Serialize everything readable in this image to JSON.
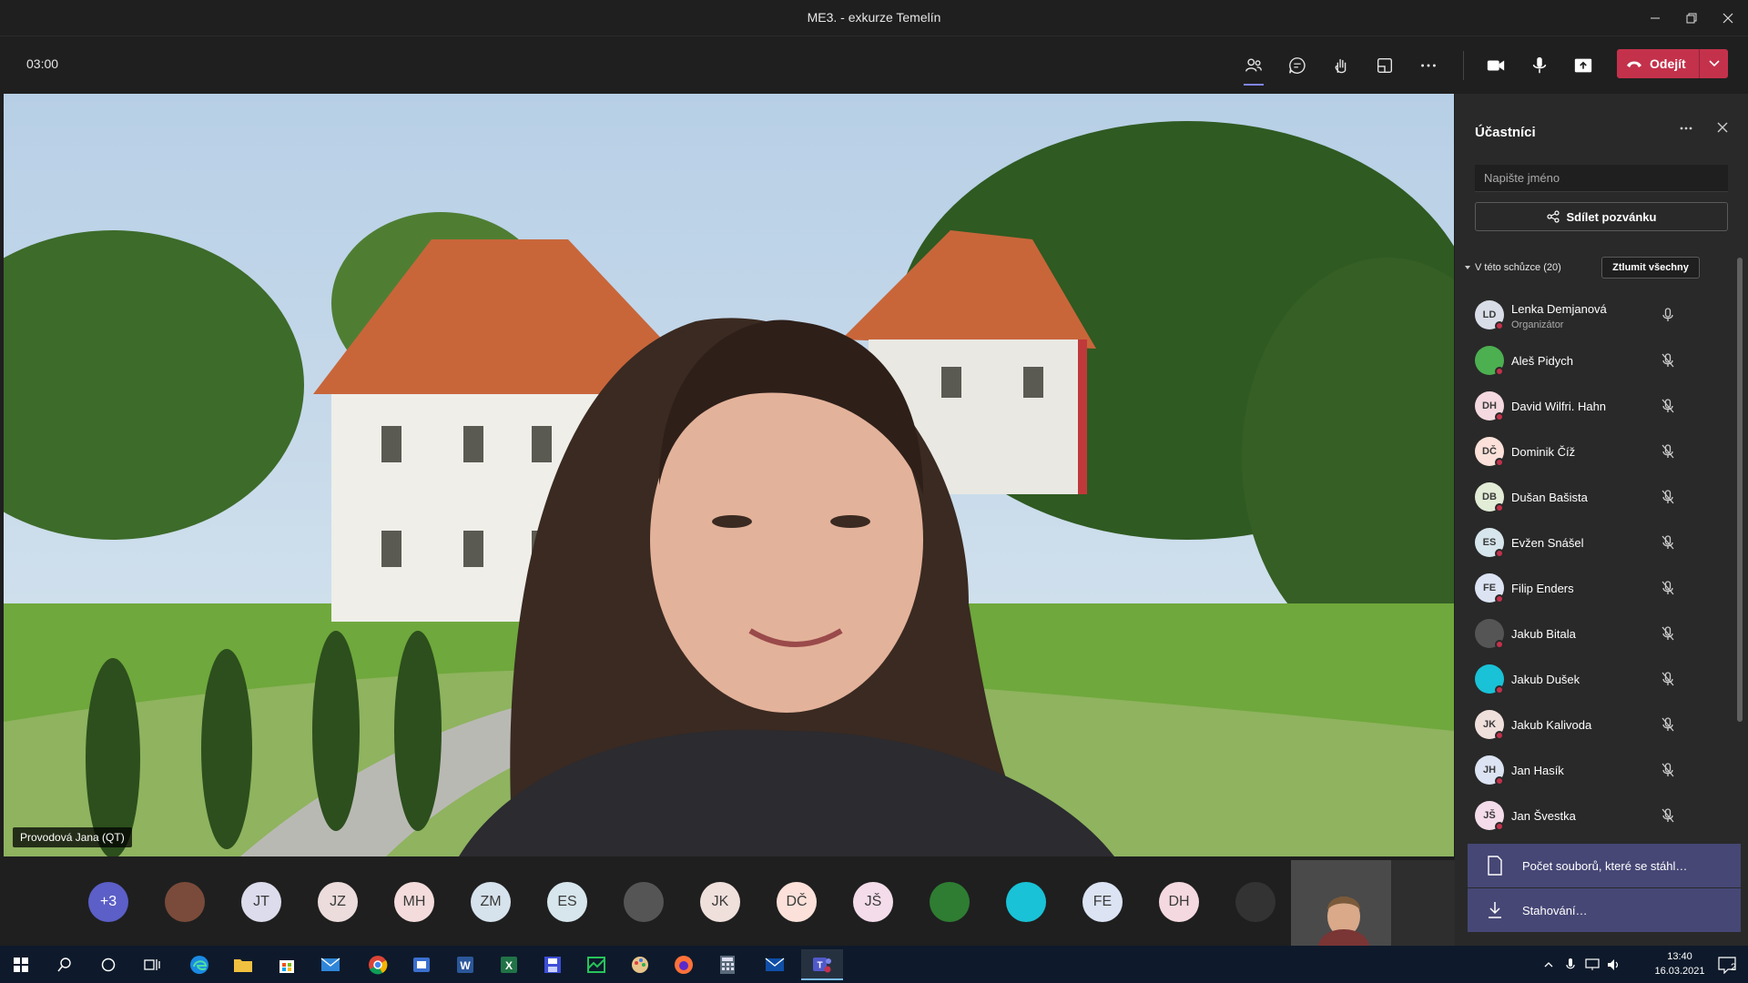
{
  "window": {
    "title": "ME3. - exkurze Temelín"
  },
  "toolbar": {
    "timer": "03:00",
    "leave_label": "Odejít"
  },
  "video": {
    "name_tag": "Provodová Jana (QT)"
  },
  "panel": {
    "title": "Účastníci",
    "search_placeholder": "Napište jméno",
    "share_label": "Sdílet pozvánku",
    "section_label": "V této schůzce (20)",
    "mute_all_label": "Ztlumit všechny",
    "participants": [
      {
        "initials": "LD",
        "name": "Lenka Demjanová",
        "role": "Organizátor",
        "color": "#d9dde8",
        "mic": "on"
      },
      {
        "initials": "",
        "name": "Aleš Pidych",
        "role": "",
        "color": "#4caf50",
        "mic": "off"
      },
      {
        "initials": "DH",
        "name": "David Wilfri. Hahn",
        "role": "",
        "color": "#f5d9e0",
        "mic": "off"
      },
      {
        "initials": "DČ",
        "name": "Dominik Číž",
        "role": "",
        "color": "#fbe1d9",
        "mic": "off"
      },
      {
        "initials": "DB",
        "name": "Dušan Bašista",
        "role": "",
        "color": "#e2ecd6",
        "mic": "off"
      },
      {
        "initials": "ES",
        "name": "Evžen Snášel",
        "role": "",
        "color": "#d6e6ec",
        "mic": "off"
      },
      {
        "initials": "FE",
        "name": "Filip Enders",
        "role": "",
        "color": "#dce4f4",
        "mic": "off"
      },
      {
        "initials": "",
        "name": "Jakub Bitala",
        "role": "",
        "color": "#555555",
        "mic": "off"
      },
      {
        "initials": "",
        "name": "Jakub Dušek",
        "role": "",
        "color": "#19c2d6",
        "mic": "off"
      },
      {
        "initials": "JK",
        "name": "Jakub Kalivoda",
        "role": "",
        "color": "#f0e0dc",
        "mic": "off"
      },
      {
        "initials": "JH",
        "name": "Jan Hasík",
        "role": "",
        "color": "#dce4f4",
        "mic": "off"
      },
      {
        "initials": "JŠ",
        "name": "Jan Švestka",
        "role": "",
        "color": "#f4dcea",
        "mic": "off"
      }
    ]
  },
  "notifications": [
    {
      "text": "Počet souborů, které se stáhl…"
    },
    {
      "text": "Stahování…"
    }
  ],
  "strip": {
    "avatars": [
      {
        "label": "+3",
        "color": "#5b5fc7",
        "text_color": "#ffffff"
      },
      {
        "label": "",
        "color": "#7a4b3a",
        "text_color": "#ffffff"
      },
      {
        "label": "JT",
        "color": "#dcdcec",
        "text_color": "#3a3a3a"
      },
      {
        "label": "JZ",
        "color": "#ecdcdc",
        "text_color": "#3a3a3a"
      },
      {
        "label": "MH",
        "color": "#f4dcdc",
        "text_color": "#3a3a3a"
      },
      {
        "label": "ZM",
        "color": "#d6e2ec",
        "text_color": "#3a3a3a"
      },
      {
        "label": "ES",
        "color": "#d6e6ec",
        "text_color": "#3a3a3a"
      },
      {
        "label": "",
        "color": "#555555",
        "text_color": "#ffffff"
      },
      {
        "label": "JK",
        "color": "#f0e0dc",
        "text_color": "#3a3a3a"
      },
      {
        "label": "DČ",
        "color": "#fbe1d9",
        "text_color": "#3a3a3a"
      },
      {
        "label": "JŠ",
        "color": "#f4dcea",
        "text_color": "#3a3a3a"
      },
      {
        "label": "",
        "color": "#2e7d32",
        "text_color": "#ffffff"
      },
      {
        "label": "",
        "color": "#19c2d6",
        "text_color": "#ffffff"
      },
      {
        "label": "FE",
        "color": "#dce4f4",
        "text_color": "#3a3a3a"
      },
      {
        "label": "DH",
        "color": "#f5d9e0",
        "text_color": "#3a3a3a"
      },
      {
        "label": "",
        "color": "#333333",
        "text_color": "#ffffff"
      }
    ]
  },
  "taskbar": {
    "time": "13:40",
    "date": "16.03.2021",
    "notification_count": "2"
  },
  "colors": {
    "accent": "#5b5fc7",
    "leave": "#c4314b",
    "panel_bg": "#292929",
    "notification": "#464775"
  }
}
